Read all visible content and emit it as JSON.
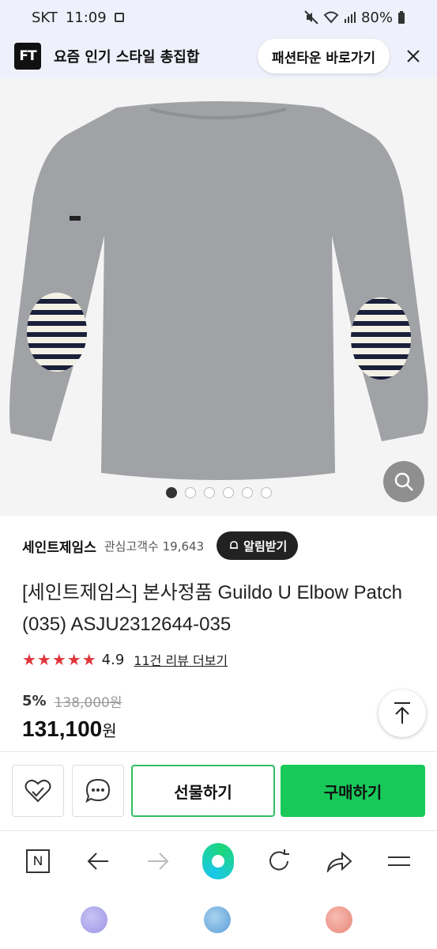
{
  "status": {
    "carrier": "SKT",
    "time": "11:09",
    "battery": "80%"
  },
  "banner": {
    "logo": "FT",
    "text": "요즘 인기 스타일 총집합",
    "button": "패션타운 바로가기"
  },
  "gallery": {
    "total_images": 6,
    "active_index": 0
  },
  "product": {
    "brand": "세인트제임스",
    "watchers_label": "관심고객수",
    "watchers_count": "19,643",
    "alert_button": "알림받기",
    "title": "[세인트제임스] 본사정품 Guildo U Elbow Patch (035) ASJU2312644-035",
    "stars": "★★★★★",
    "rating": "4.9",
    "review_link": "11건 리뷰 더보기",
    "discount": "5%",
    "original_price": "138,000원",
    "price": "131,100",
    "price_unit": "원"
  },
  "actions": {
    "gift_label": "선물하기",
    "buy_label": "구매하기"
  },
  "colors": {
    "accent": "#18c95a",
    "star": "#e0353b"
  },
  "tabs": [
    {
      "color": "#a9a3ea"
    },
    {
      "color": "#7ab3e0"
    },
    {
      "color": "#ef9a8e"
    }
  ]
}
